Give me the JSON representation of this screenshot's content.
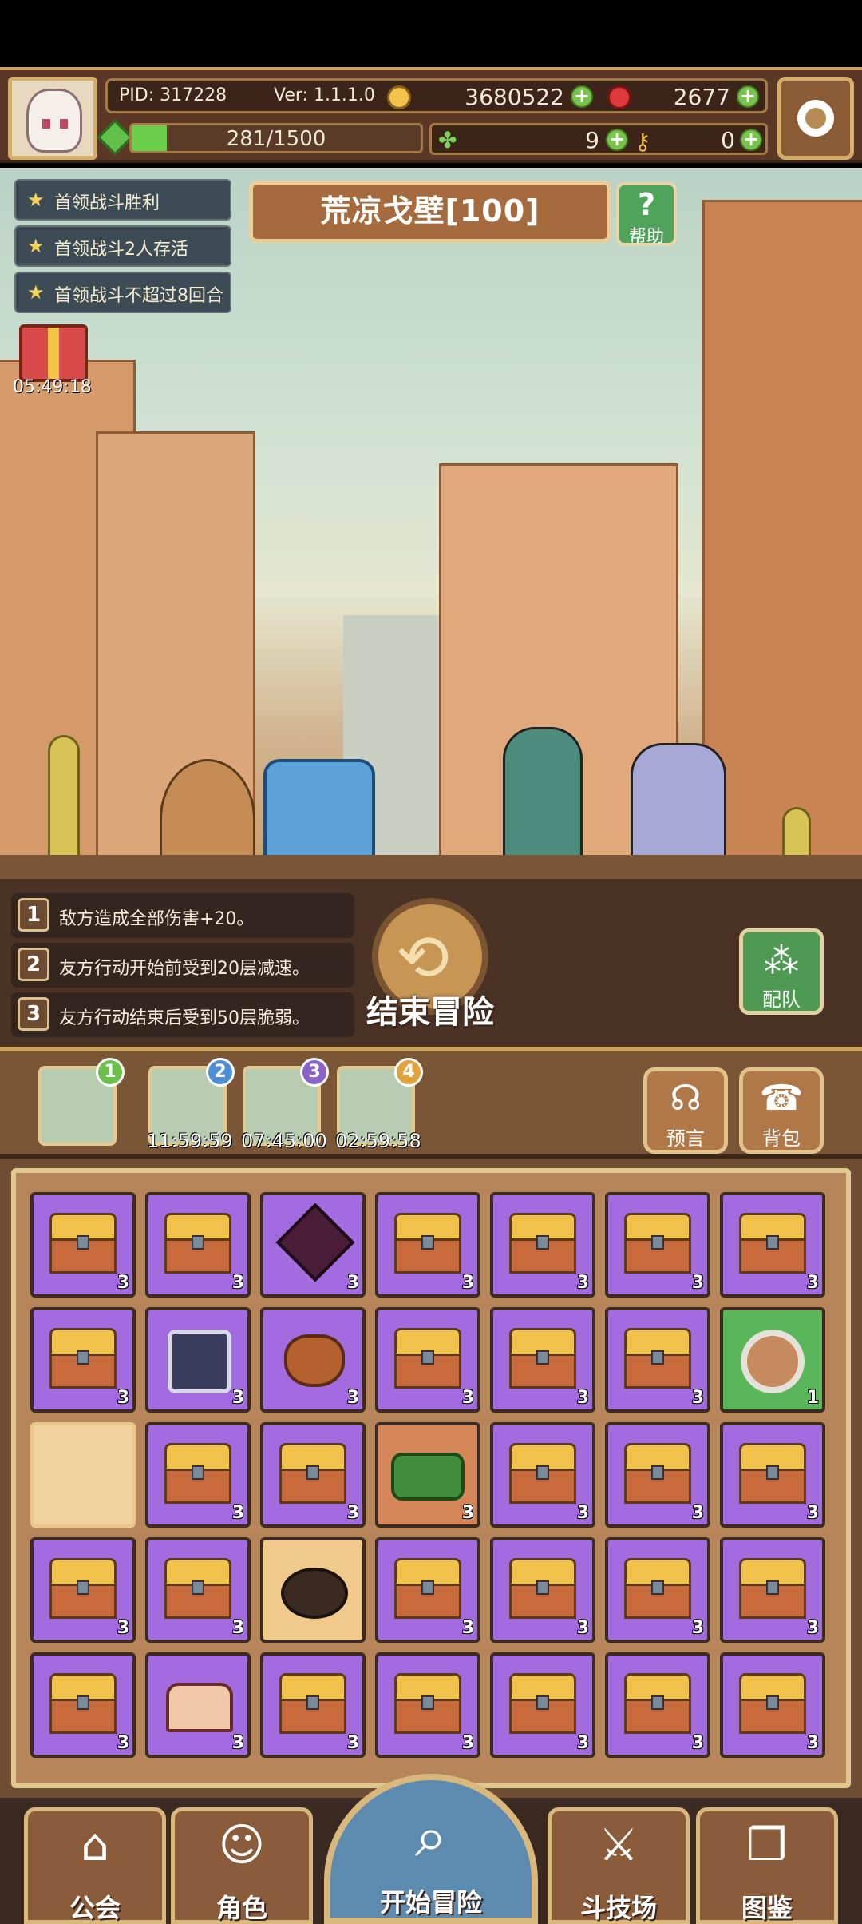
{
  "hud": {
    "pid": "PID: 317228",
    "version": "Ver: 1.1.1.0",
    "gold": "3680522",
    "gems": "2677",
    "energy": "281/1500",
    "clover": "9",
    "key": "0"
  },
  "quests": [
    "首领战斗胜利",
    "首领战斗2人存活",
    "首领战斗不超过8回合"
  ],
  "stage": {
    "title": "荒凉戈壁[100]",
    "help_label": "帮助",
    "help_icon": "?"
  },
  "gift": {
    "timer": "05:49:18"
  },
  "rules": [
    {
      "num": "1",
      "text": "敌方造成全部伤害+20。"
    },
    {
      "num": "2",
      "text": "友方行动开始前受到20层减速。"
    },
    {
      "num": "3",
      "text": "友方行动结束后受到50层脆弱。"
    }
  ],
  "end_button": {
    "label": "结束冒险",
    "icon": "⟲"
  },
  "team_button": {
    "label": "配队",
    "icon": "⁂"
  },
  "stages": [
    {
      "badge": "1",
      "time": "",
      "color": "#6cbf4b"
    },
    {
      "badge": "2",
      "time": "11:59:59",
      "color": "#4f8fd8"
    },
    {
      "badge": "3",
      "time": "07:45:00",
      "color": "#8b62c8"
    },
    {
      "badge": "4",
      "time": "02:59:58",
      "color": "#e0a33b"
    }
  ],
  "side_buttons": {
    "prophecy": "预言",
    "backpack": "背包"
  },
  "inventory": [
    {
      "type": "chest",
      "bg": "purple",
      "count": "3"
    },
    {
      "type": "chest",
      "bg": "purple",
      "count": "3"
    },
    {
      "type": "gem",
      "bg": "purple",
      "count": "3"
    },
    {
      "type": "chest",
      "bg": "purple",
      "count": "3"
    },
    {
      "type": "chest",
      "bg": "purple",
      "count": "3"
    },
    {
      "type": "chest",
      "bg": "purple",
      "count": "3"
    },
    {
      "type": "chest",
      "bg": "purple",
      "count": "3"
    },
    {
      "type": "chest",
      "bg": "purple",
      "count": "3"
    },
    {
      "type": "storage",
      "bg": "purple",
      "count": "3"
    },
    {
      "type": "bag",
      "bg": "purple",
      "count": "3"
    },
    {
      "type": "chest",
      "bg": "purple",
      "count": "3"
    },
    {
      "type": "chest",
      "bg": "purple",
      "count": "3"
    },
    {
      "type": "chest",
      "bg": "purple",
      "count": "3"
    },
    {
      "type": "shield",
      "bg": "green",
      "count": "1"
    },
    {
      "type": "empty",
      "bg": "empty",
      "count": ""
    },
    {
      "type": "chest",
      "bg": "purple",
      "count": "3"
    },
    {
      "type": "chest",
      "bg": "purple",
      "count": "3"
    },
    {
      "type": "greenbox",
      "bg": "orange",
      "count": "3"
    },
    {
      "type": "chest",
      "bg": "purple",
      "count": "3"
    },
    {
      "type": "chest",
      "bg": "purple",
      "count": "3"
    },
    {
      "type": "chest",
      "bg": "purple",
      "count": "3"
    },
    {
      "type": "chest",
      "bg": "purple",
      "count": "3"
    },
    {
      "type": "chest",
      "bg": "purple",
      "count": "3"
    },
    {
      "type": "pot",
      "bg": "gold",
      "count": ""
    },
    {
      "type": "chest",
      "bg": "purple",
      "count": "3"
    },
    {
      "type": "chest",
      "bg": "purple",
      "count": "3"
    },
    {
      "type": "chest",
      "bg": "purple",
      "count": "3"
    },
    {
      "type": "chest",
      "bg": "purple",
      "count": "3"
    },
    {
      "type": "chest",
      "bg": "purple",
      "count": "3"
    },
    {
      "type": "pinkbox",
      "bg": "purple",
      "count": "3"
    },
    {
      "type": "chest",
      "bg": "purple",
      "count": "3"
    },
    {
      "type": "chest",
      "bg": "purple",
      "count": "3"
    },
    {
      "type": "chest",
      "bg": "purple",
      "count": "3"
    },
    {
      "type": "chest",
      "bg": "purple",
      "count": "3"
    },
    {
      "type": "chest",
      "bg": "purple",
      "count": "3"
    }
  ],
  "nav": {
    "guild": "公会",
    "character": "角色",
    "start": "开始冒险",
    "arena": "斗技场",
    "codex": "图鉴"
  }
}
